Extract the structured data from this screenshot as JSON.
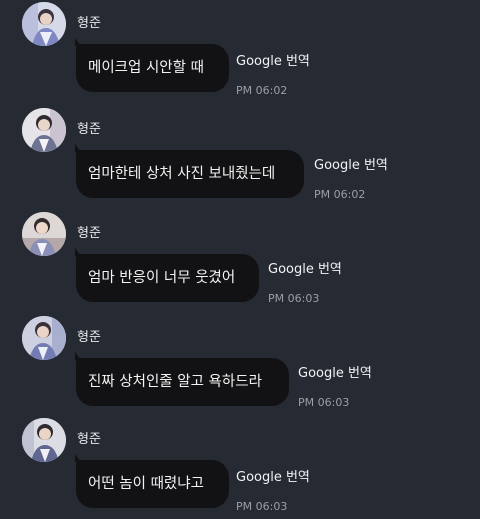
{
  "messages": [
    {
      "sender": "형준",
      "text": "메이크업 시안할 때",
      "translate": "Google 번역",
      "time": "PM 06:02"
    },
    {
      "sender": "형준",
      "text": "엄마한테 상처 사진 보내줬는데",
      "translate": "Google 번역",
      "time": "PM 06:02"
    },
    {
      "sender": "형준",
      "text": "엄마 반응이 너무 웃겼어",
      "translate": "Google 번역",
      "time": "PM 06:03"
    },
    {
      "sender": "형준",
      "text": "진짜 상처인줄 알고 욕하드라",
      "translate": "Google 번역",
      "time": "PM 06:03"
    },
    {
      "sender": "형준",
      "text": "어떤 놈이 때렸냐고",
      "translate": "Google 번역",
      "time": "PM 06:03"
    }
  ]
}
